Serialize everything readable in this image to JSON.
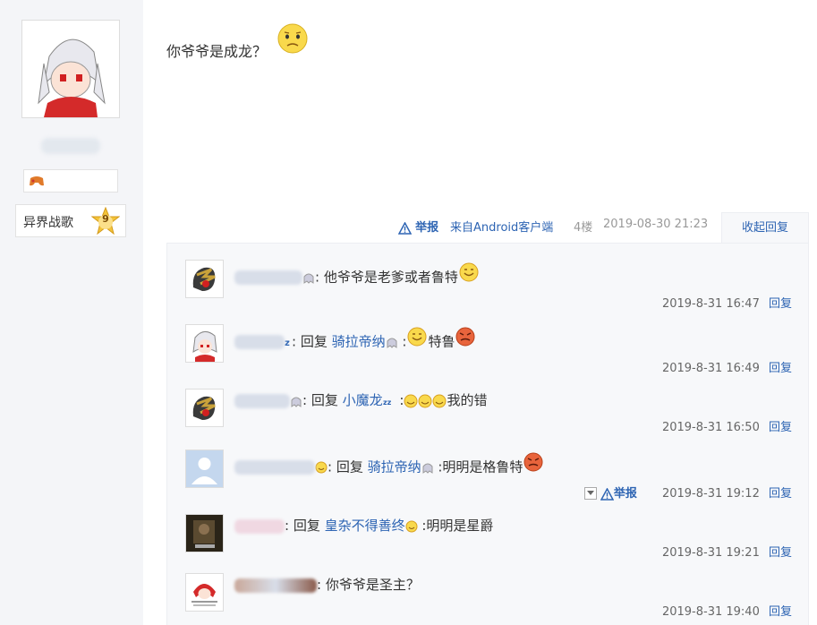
{
  "user": {
    "level_name": "异界战歌",
    "level": "9"
  },
  "post": {
    "text": "你爷爷是成龙？",
    "report": "举报",
    "source": "来自Android客户端",
    "floor": "4楼",
    "time": "2019-08-30 21:23",
    "collapse": "收起回复"
  },
  "replies": [
    {
      "prefix": ": 他爷爷是老爹或者鲁特",
      "target": "",
      "content": "",
      "time": "2019-8-31 16:47",
      "reply": "回复"
    },
    {
      "prefix": ": 回复 ",
      "target": "骑拉帝纳",
      "content": " :",
      "content2": "特鲁",
      "time": "2019-8-31 16:49",
      "reply": "回复"
    },
    {
      "prefix": ": 回复 ",
      "target": "小魔龙",
      "content": " :",
      "content2": "我的错",
      "time": "2019-8-31 16:50",
      "reply": "回复"
    },
    {
      "prefix": ": 回复 ",
      "target": "骑拉帝纳",
      "content": " :明明是格鲁特",
      "time": "2019-8-31 19:12",
      "reply": "回复",
      "report": "举报"
    },
    {
      "prefix": ": 回复 ",
      "target": "皇杂不得善终",
      "content": " :明明是星爵",
      "time": "2019-8-31 19:21",
      "reply": "回复"
    },
    {
      "prefix": ": 你爷爷是圣主？",
      "target": "",
      "content": "",
      "time": "2019-8-31 19:40",
      "reply": "回复"
    }
  ],
  "colors": {
    "link": "#2d64b3",
    "panel": "#f7f8fa"
  }
}
